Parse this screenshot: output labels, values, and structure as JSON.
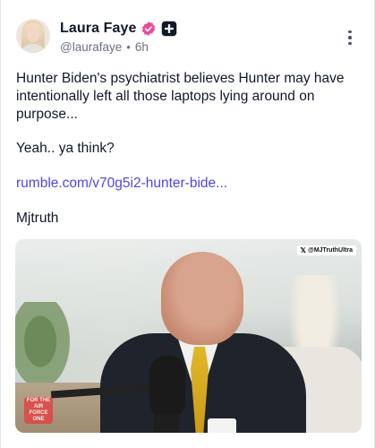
{
  "post": {
    "author": {
      "display_name": "Laura Faye",
      "handle": "@laurafaye",
      "time_ago": "6h"
    },
    "text_paragraph_1": "Hunter Biden's psychiatrist believes Hunter may have intentionally left all those laptops lying around on purpose...",
    "text_paragraph_2": "Yeah.. ya think?",
    "link_text": "rumble.com/v70g5i2-hunter-bide...",
    "text_paragraph_3": "Mjtruth",
    "media": {
      "watermark": "@MJTruthUltra",
      "logo_text": "AIR FORCE ONE",
      "logo_subtext": "FOR THE"
    }
  },
  "colors": {
    "link": "#4f46e5",
    "verified_badge": "#ec4899",
    "secondary_text": "#6b7280"
  },
  "icons": {
    "verified": "verified-check-icon",
    "plus_badge": "plus-badge-icon",
    "more": "more-vertical-icon"
  }
}
